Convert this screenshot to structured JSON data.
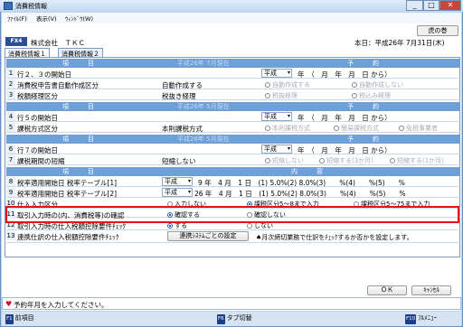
{
  "window": {
    "title": "消費税情報",
    "min": "_",
    "max": "□",
    "close": "✕"
  },
  "menu": [
    "ﾌｧｲﾙ(F)",
    "表示(V)",
    "ｳｨﾝﾄﾞｳ(W)"
  ],
  "help_label": "虎の巻",
  "company": {
    "badge": "FX4",
    "name": "株式会社　ＴＫＣ",
    "date": "本日：平成26年 7月31日(木)"
  },
  "tabs": [
    "消費税情報１",
    "消費税情報２"
  ],
  "section1": {
    "col1": "項　　　目",
    "col2": "平成26年 7月現在",
    "col3": "予　　　約"
  },
  "rows1": [
    {
      "num": "1",
      "label": "行２、３の開始日",
      "era": "平成",
      "date": "年　（　月　年　月　日 から）"
    },
    {
      "num": "2",
      "label": "消費税申告書自動作成区分",
      "value": "自動作成する",
      "opt1": "自動作成する",
      "opt2": "自動作成しない"
    },
    {
      "num": "3",
      "label": "税額経理区分",
      "value": "税抜き経理",
      "opt1": "税抜経理",
      "opt2": "税込み経理"
    }
  ],
  "section2": {
    "col1": "項　　　目",
    "col2": "平成26年 5月現在",
    "col3": "予　　　約"
  },
  "rows2": [
    {
      "num": "4",
      "label": "行５の開始日",
      "era": "平成",
      "date": "年　（　月　年　月　日 から）"
    },
    {
      "num": "5",
      "label": "課税方式区分",
      "value": "本則課税方式",
      "opt1": "本則課税方式",
      "opt2": "簡易課税方式",
      "opt3": "免税事業者"
    }
  ],
  "section3": {
    "col1": "項　　　目",
    "col2": "平成26年 5月現在",
    "col3": "予　　　約"
  },
  "rows3": [
    {
      "num": "6",
      "label": "行７の開始日",
      "era": "平成",
      "date": "年　（　月　年　月　日 から）"
    },
    {
      "num": "7",
      "label": "課税期間の短縮",
      "value": "短縮しない",
      "opt1": "短縮しない",
      "opt2": "短縮する(3か月)",
      "opt3": "短縮する(1か月)"
    }
  ],
  "section4": {
    "col1": "項　　　目",
    "col2": "内　　　容"
  },
  "rows4": [
    {
      "num": "8",
      "label": "税率適用開始日 税率テーブル[1]",
      "era": "平成",
      "detail": "9 年　4 月　1 日　(1) 5.0%(2) 8.0%(3)　　%(4)　　%(5)　　%"
    },
    {
      "num": "9",
      "label": "税率適用開始日 税率テーブル[2]",
      "era": "平成",
      "detail": "26 年　4 月　1 日　(1) 5.0%(2) 8.0%(3)　　%(4)　　%(5)　　%"
    },
    {
      "num": "10",
      "label": "仕入入力区分",
      "opt1": "入力しない",
      "opt2": "課税区分5～8まで入力",
      "opt3": "課税区分5～75まで入力"
    },
    {
      "num": "11",
      "label": "取引入力時の(内、消費税等)の確認",
      "opt1": "確認する",
      "opt2": "確認しない"
    },
    {
      "num": "12",
      "label": "取引入力時の仕入税額控除要件ﾁｪｯｸ",
      "opt1": "する",
      "opt2": "しない"
    },
    {
      "num": "13",
      "label": "連携仕訳の仕入税額控除要件ﾁｪｯｸ",
      "button": "連携ｼｽﾃﾑごとの設定",
      "note": "♠月次締切業務で仕訳をﾁｪｯｸするか否かを設定します。"
    }
  ],
  "buttons": {
    "ok": "ＯＫ",
    "cancel": "ｷｬﾝｾﾙ"
  },
  "message": "予約年月を入力してください。",
  "fkeys": {
    "f1": "前項目",
    "f6": "タブ切替",
    "f10": "ﾌﾙﾒﾆｭｰ",
    "f1_key": "F1",
    "f6_key": "F6",
    "f10_key": "F10"
  }
}
